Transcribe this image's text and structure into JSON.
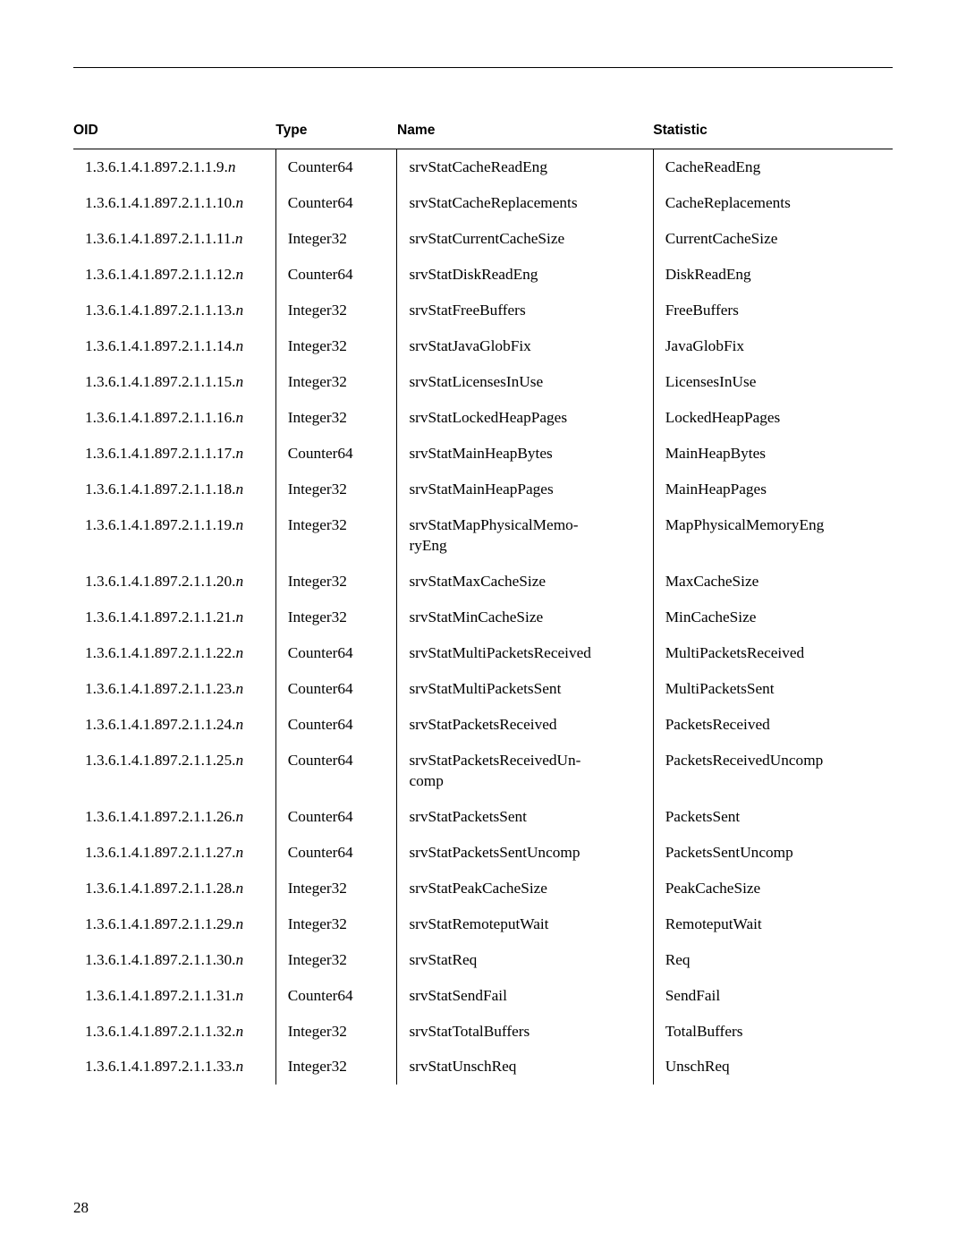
{
  "headers": {
    "oid": "OID",
    "type": "Type",
    "name": "Name",
    "stat": "Statistic"
  },
  "rows": [
    {
      "oid_pre": "1.3.6.1.4.1.897.2.1.1.9.",
      "oid_suf": "n",
      "type": "Counter64",
      "name": "srvStatCacheReadEng",
      "stat": "CacheReadEng"
    },
    {
      "oid_pre": "1.3.6.1.4.1.897.2.1.1.10.",
      "oid_suf": "n",
      "type": "Counter64",
      "name": "srvStatCacheReplacements",
      "stat": "CacheReplacements"
    },
    {
      "oid_pre": "1.3.6.1.4.1.897.2.1.1.11.",
      "oid_suf": "n",
      "type": "Integer32",
      "name": "srvStatCurrentCacheSize",
      "stat": "CurrentCacheSize"
    },
    {
      "oid_pre": "1.3.6.1.4.1.897.2.1.1.12.",
      "oid_suf": "n",
      "type": "Counter64",
      "name": "srvStatDiskReadEng",
      "stat": "DiskReadEng"
    },
    {
      "oid_pre": "1.3.6.1.4.1.897.2.1.1.13.",
      "oid_suf": "n",
      "type": "Integer32",
      "name": "srvStatFreeBuffers",
      "stat": "FreeBuffers"
    },
    {
      "oid_pre": "1.3.6.1.4.1.897.2.1.1.14.",
      "oid_suf": "n",
      "type": "Integer32",
      "name": "srvStatJavaGlobFix",
      "stat": "JavaGlobFix"
    },
    {
      "oid_pre": "1.3.6.1.4.1.897.2.1.1.15.",
      "oid_suf": "n",
      "type": "Integer32",
      "name": "srvStatLicensesInUse",
      "stat": "LicensesInUse"
    },
    {
      "oid_pre": "1.3.6.1.4.1.897.2.1.1.16.",
      "oid_suf": "n",
      "type": "Integer32",
      "name": "srvStatLockedHeapPages",
      "stat": "LockedHeapPages"
    },
    {
      "oid_pre": "1.3.6.1.4.1.897.2.1.1.17.",
      "oid_suf": "n",
      "type": "Counter64",
      "name": "srvStatMainHeapBytes",
      "stat": "MainHeapBytes"
    },
    {
      "oid_pre": "1.3.6.1.4.1.897.2.1.1.18.",
      "oid_suf": "n",
      "type": "Integer32",
      "name": "srvStatMainHeapPages",
      "stat": "MainHeapPages"
    },
    {
      "oid_pre": "1.3.6.1.4.1.897.2.1.1.19.",
      "oid_suf": "n",
      "type": "Integer32",
      "name": "srvStatMapPhysicalMemo-\nryEng",
      "stat": "MapPhysicalMemoryEng"
    },
    {
      "oid_pre": "1.3.6.1.4.1.897.2.1.1.20.",
      "oid_suf": "n",
      "type": "Integer32",
      "name": "srvStatMaxCacheSize",
      "stat": "MaxCacheSize"
    },
    {
      "oid_pre": "1.3.6.1.4.1.897.2.1.1.21.",
      "oid_suf": "n",
      "type": "Integer32",
      "name": "srvStatMinCacheSize",
      "stat": "MinCacheSize"
    },
    {
      "oid_pre": "1.3.6.1.4.1.897.2.1.1.22.",
      "oid_suf": "n",
      "type": "Counter64",
      "name": "srvStatMultiPacketsReceived",
      "stat": "MultiPacketsReceived"
    },
    {
      "oid_pre": "1.3.6.1.4.1.897.2.1.1.23.",
      "oid_suf": "n",
      "type": "Counter64",
      "name": "srvStatMultiPacketsSent",
      "stat": "MultiPacketsSent"
    },
    {
      "oid_pre": "1.3.6.1.4.1.897.2.1.1.24.",
      "oid_suf": "n",
      "type": "Counter64",
      "name": "srvStatPacketsReceived",
      "stat": "PacketsReceived"
    },
    {
      "oid_pre": "1.3.6.1.4.1.897.2.1.1.25.",
      "oid_suf": "n",
      "type": "Counter64",
      "name": "srvStatPacketsReceivedUn-\ncomp",
      "stat": "PacketsReceivedUncomp"
    },
    {
      "oid_pre": "1.3.6.1.4.1.897.2.1.1.26.",
      "oid_suf": "n",
      "type": "Counter64",
      "name": "srvStatPacketsSent",
      "stat": "PacketsSent"
    },
    {
      "oid_pre": "1.3.6.1.4.1.897.2.1.1.27.",
      "oid_suf": "n",
      "type": "Counter64",
      "name": "srvStatPacketsSentUncomp",
      "stat": "PacketsSentUncomp"
    },
    {
      "oid_pre": "1.3.6.1.4.1.897.2.1.1.28.",
      "oid_suf": "n",
      "type": "Integer32",
      "name": "srvStatPeakCacheSize",
      "stat": "PeakCacheSize"
    },
    {
      "oid_pre": "1.3.6.1.4.1.897.2.1.1.29.",
      "oid_suf": "n",
      "type": "Integer32",
      "name": "srvStatRemoteputWait",
      "stat": "RemoteputWait"
    },
    {
      "oid_pre": "1.3.6.1.4.1.897.2.1.1.30.",
      "oid_suf": "n",
      "type": "Integer32",
      "name": "srvStatReq",
      "stat": "Req"
    },
    {
      "oid_pre": "1.3.6.1.4.1.897.2.1.1.31.",
      "oid_suf": "n",
      "type": "Counter64",
      "name": "srvStatSendFail",
      "stat": "SendFail"
    },
    {
      "oid_pre": "1.3.6.1.4.1.897.2.1.1.32.",
      "oid_suf": "n",
      "type": "Integer32",
      "name": "srvStatTotalBuffers",
      "stat": "TotalBuffers"
    },
    {
      "oid_pre": "1.3.6.1.4.1.897.2.1.1.33.",
      "oid_suf": "n",
      "type": "Integer32",
      "name": "srvStatUnschReq",
      "stat": "UnschReq"
    }
  ],
  "page_number": "28"
}
